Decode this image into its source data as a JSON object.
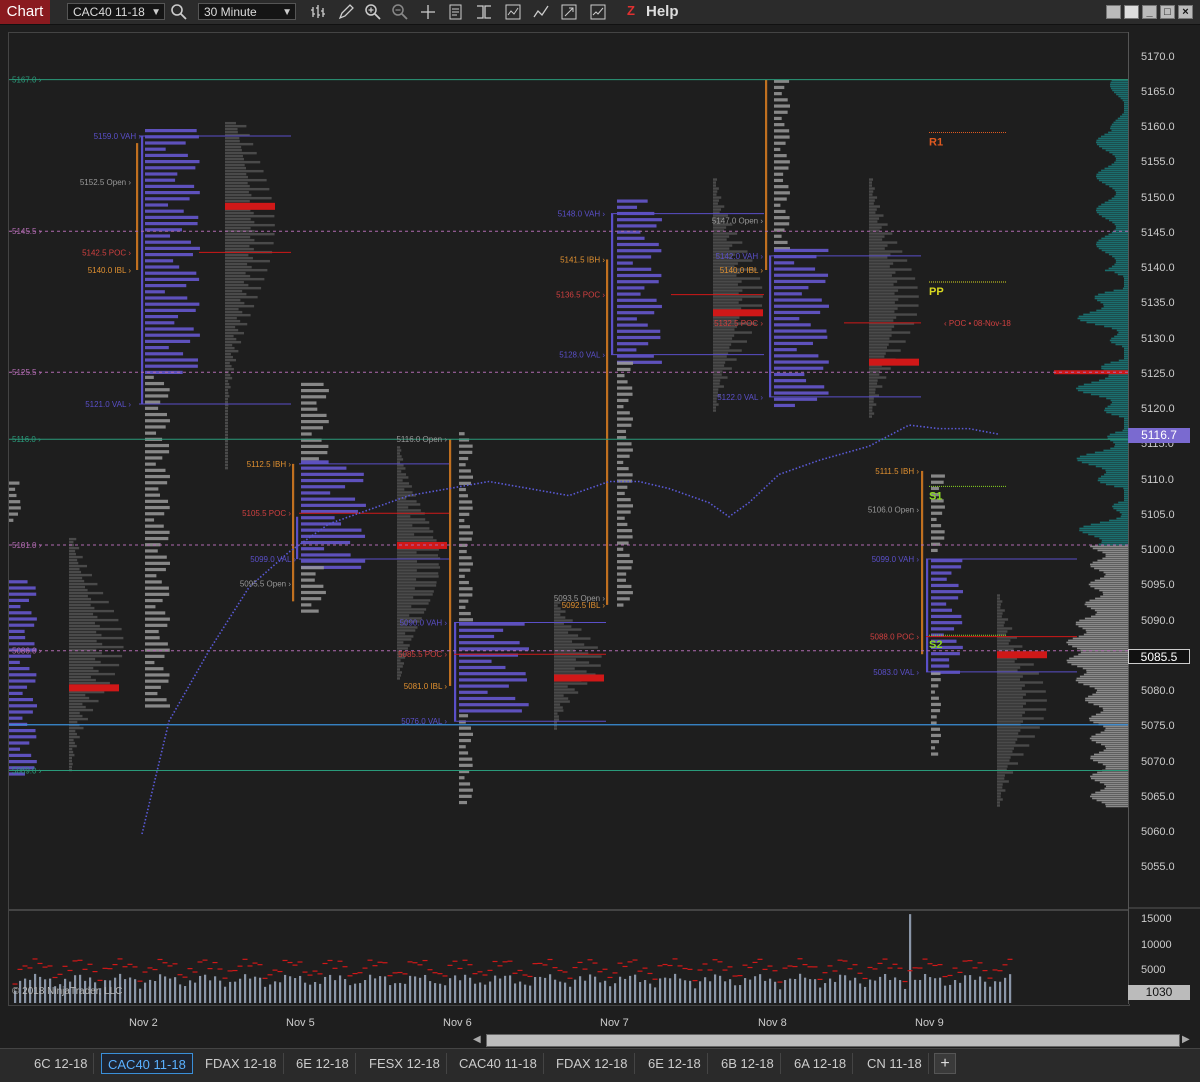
{
  "toolbar": {
    "title": "Chart",
    "instrument": "CAC40 11-18",
    "interval": "30 Minute",
    "help": "Help",
    "z": "Z",
    "icons": [
      "bar-type-icon",
      "draw-pencil-icon",
      "zoom-in-icon",
      "zoom-out-icon",
      "crosshair-icon",
      "properties-icon",
      "data-box-icon",
      "templates-icon",
      "strategies-icon",
      "snapshot-icon",
      "indicators-icon"
    ]
  },
  "price_axis": {
    "labels": [
      "5170.0",
      "5165.0",
      "5160.0",
      "5155.0",
      "5150.0",
      "5145.0",
      "5140.0",
      "5135.0",
      "5130.0",
      "5125.0",
      "5120.0",
      "5115.0",
      "5110.0",
      "5105.0",
      "5100.0",
      "5095.0",
      "5090.0",
      "5085.0",
      "5080.0",
      "5075.0",
      "5070.0",
      "5065.0",
      "5060.0",
      "5055.0"
    ],
    "last_price": "5085.5",
    "marker_price": "5116.7"
  },
  "volume_axis": {
    "labels": [
      "15000",
      "10000",
      "5000"
    ],
    "current": "1030"
  },
  "date_axis": [
    "Nov 2",
    "Nov 5",
    "Nov 6",
    "Nov 7",
    "Nov 8",
    "Nov 9"
  ],
  "copyright": "© 2018 NinjaTrader, LLC",
  "level_labels": {
    "l5167": "5167.0",
    "l5145": "5145.5",
    "l5125": "5125.5",
    "l5116": "5116.0",
    "l5101": "5101.0",
    "l5086": "5086.0",
    "l5069": "5069.0"
  },
  "profile_labels": {
    "nov2": [
      "5159.0 VAH",
      "5152.5 Open",
      "5142.5 POC",
      "5140.0 IBL",
      "5121.0 VAL"
    ],
    "nov5": [
      "5112.5 IBH",
      "5105.5 POC",
      "5099.0 VAL",
      "5095.5 Open"
    ],
    "nov6": [
      "5116.0 Open",
      "5090.0 VAH",
      "5085.5 POC",
      "5081.0 IBL",
      "5076.0 VAL"
    ],
    "nov7": [
      "5148.0 VAH",
      "5141.5 IBH",
      "5136.5 POC",
      "5128.0 VAL",
      "5093.5 Open",
      "5092.5 IBL"
    ],
    "nov8": [
      "5147.0 Open",
      "5142.0 VAH",
      "5140.0 IBL",
      "5132.5 POC",
      "5122.0 VAL"
    ],
    "nov9": [
      "5111.5 IBH",
      "5106.0 Open",
      "5099.0 VAH",
      "5088.0 POC",
      "5083.0 VAL"
    ]
  },
  "pivots": {
    "r1": "R1",
    "pp": "PP",
    "s1": "S1",
    "s2": "S2"
  },
  "poc_note": "POC • 08-Nov-18",
  "tabs": [
    "6C 12-18",
    "CAC40 11-18",
    "FDAX 12-18",
    "6E 12-18",
    "FESX 12-18",
    "CAC40 11-18",
    "FDAX 12-18",
    "6E 12-18",
    "6B 12-18",
    "6A 12-18",
    "CN 11-18"
  ],
  "active_tab": 1,
  "colors": {
    "background": "#1e1e1e",
    "title_red": "#8a1a1f",
    "poc_red": "#d01818",
    "teal": "#1a6e6e",
    "vah_blue": "#5a4fc8",
    "ib_orange": "#c07020",
    "green_level": "#2a9a7a",
    "pink_level": "#b06ab0",
    "vwap_blue": "#5a5ad8",
    "marker_purple": "#7a6ad0"
  }
}
